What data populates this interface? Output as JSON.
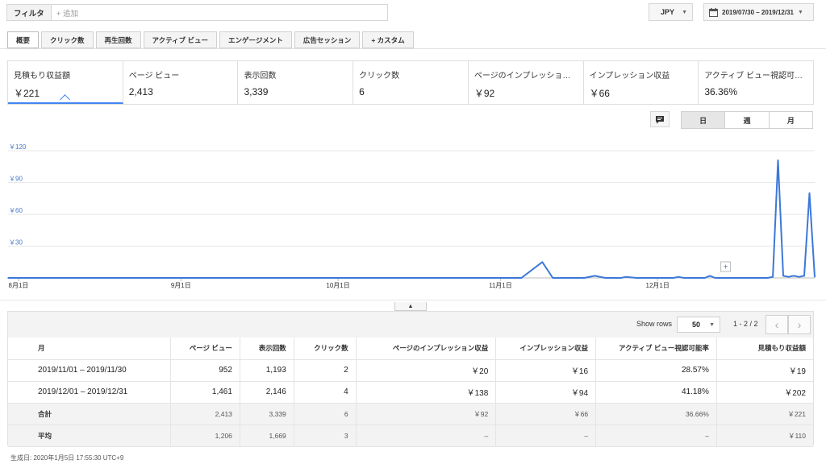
{
  "filter": {
    "label": "フィルタ",
    "add_text": "+ 追加"
  },
  "currency": {
    "value": "JPY"
  },
  "date_range": {
    "value": "2019/07/30 – 2019/12/31"
  },
  "tabs": [
    {
      "label": "概要"
    },
    {
      "label": "クリック数"
    },
    {
      "label": "再生回数"
    },
    {
      "label": "アクティブ ビュー"
    },
    {
      "label": "エンゲージメント"
    },
    {
      "label": "広告セッション"
    },
    {
      "label": "+ カスタム"
    }
  ],
  "metrics": [
    {
      "label": "見積もり収益額",
      "value": "￥221"
    },
    {
      "label": "ページ ビュー",
      "value": "2,413"
    },
    {
      "label": "表示回数",
      "value": "3,339"
    },
    {
      "label": "クリック数",
      "value": "6"
    },
    {
      "label": "ページのインプレッション…",
      "value": "￥92"
    },
    {
      "label": "インプレッション収益",
      "value": "￥66"
    },
    {
      "label": "アクティブ ビュー視認可能…",
      "value": "36.36%"
    }
  ],
  "granularity": {
    "day": "日",
    "week": "週",
    "month": "月"
  },
  "chart_data": {
    "type": "line",
    "y_ticks": [
      "￥120",
      "￥90",
      "￥60",
      "￥30"
    ],
    "ylim": [
      0,
      130
    ],
    "x_ticks": [
      "8月1日",
      "9月1日",
      "10月1日",
      "11月1日",
      "12月1日"
    ],
    "series_color": "#3c78d8",
    "annotation_marker": "+",
    "points": [
      [
        "2019-07-30",
        0
      ],
      [
        "2019-11-05",
        0
      ],
      [
        "2019-11-09",
        15
      ],
      [
        "2019-11-11",
        0
      ],
      [
        "2019-11-17",
        0
      ],
      [
        "2019-11-19",
        2
      ],
      [
        "2019-11-21",
        0
      ],
      [
        "2019-11-24",
        0
      ],
      [
        "2019-11-25",
        1
      ],
      [
        "2019-11-27",
        0
      ],
      [
        "2019-12-04",
        0
      ],
      [
        "2019-12-05",
        1
      ],
      [
        "2019-12-06",
        0
      ],
      [
        "2019-12-10",
        0
      ],
      [
        "2019-12-11",
        2
      ],
      [
        "2019-12-12",
        0
      ],
      [
        "2019-12-22",
        0
      ],
      [
        "2019-12-23",
        1
      ],
      [
        "2019-12-24",
        111
      ],
      [
        "2019-12-25",
        2
      ],
      [
        "2019-12-26",
        1
      ],
      [
        "2019-12-27",
        2
      ],
      [
        "2019-12-28",
        1
      ],
      [
        "2019-12-29",
        2
      ],
      [
        "2019-12-30",
        80
      ],
      [
        "2019-12-31",
        1
      ]
    ]
  },
  "table": {
    "show_rows_label": "Show rows",
    "rows_value": "50",
    "page_info": "1 - 2 / 2",
    "prev": "‹",
    "next": "›",
    "headers": [
      "月",
      "ページ ビュー",
      "表示回数",
      "クリック数",
      "ページのインプレッション収益",
      "インプレッション収益",
      "アクティブ ビュー視認可能率",
      "見積もり収益額"
    ],
    "rows": [
      [
        "2019/11/01 – 2019/11/30",
        "952",
        "1,193",
        "2",
        "￥20",
        "￥16",
        "28.57%",
        "￥19"
      ],
      [
        "2019/12/01 – 2019/12/31",
        "1,461",
        "2,146",
        "4",
        "￥138",
        "￥94",
        "41.18%",
        "￥202"
      ]
    ],
    "total": [
      "合計",
      "2,413",
      "3,339",
      "6",
      "￥92",
      "￥66",
      "36.66%",
      "￥221"
    ],
    "average": [
      "平均",
      "1,206",
      "1,669",
      "3",
      "–",
      "–",
      "–",
      "￥110"
    ]
  },
  "generated_text": "生成日: 2020年1月5日 17:55:30 UTC+9"
}
